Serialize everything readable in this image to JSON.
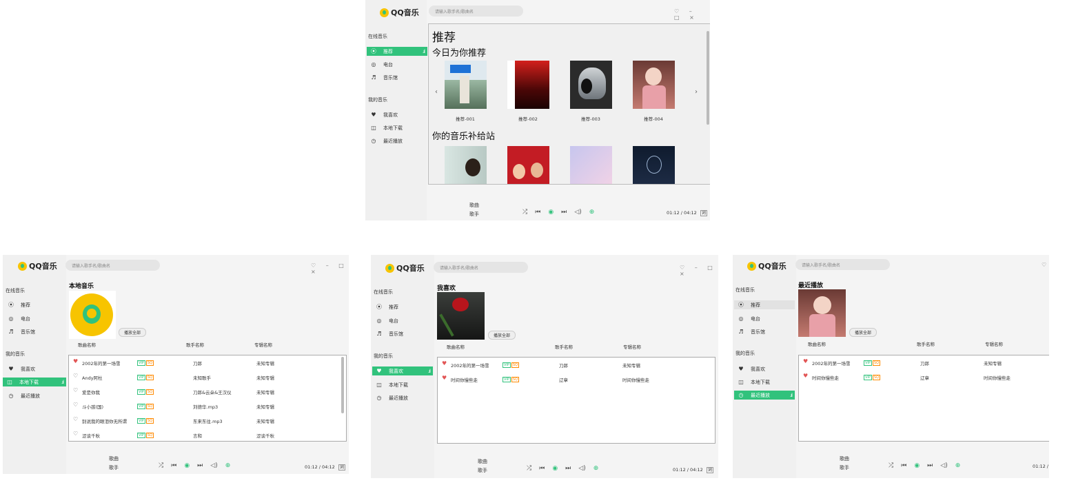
{
  "common": {
    "app_name": "QQ音乐",
    "search_placeholder": "请输入歌手名/歌曲名",
    "window_controls": "♡ – □ ×",
    "section_online": "在线音乐",
    "section_mine": "我的音乐",
    "nav": {
      "recommend": "推荐",
      "radio": "电台",
      "playlist": "音乐馆",
      "favorite": "我喜欢",
      "local": "本地下载",
      "recent": "最近播放"
    },
    "col_song": "歌曲名称",
    "col_singer": "歌手名称",
    "col_album": "专辑名称",
    "play_all": "播放全部",
    "player_song": "歌曲",
    "player_singer": "歌手",
    "player_time": "01:12 / 04:12",
    "lyric_btn": "词",
    "eq_glyph": ".ıl",
    "tag_vip": "VIP",
    "tag_sq": "SQ"
  },
  "recommend_window": {
    "page_title": "推荐",
    "section1": "今日为你推荐",
    "section2": "你的音乐补给站",
    "items": [
      "推荐-001",
      "推荐-002",
      "推荐-003",
      "推荐-004"
    ],
    "prev": "‹",
    "next": "›"
  },
  "local_window": {
    "page_title": "本地音乐",
    "rows": [
      {
        "song": "2002年的第一场雪",
        "singer": "刀郎",
        "album": "未知专辑",
        "liked": true
      },
      {
        "song": "Andy阿杜",
        "singer": "未知歌手",
        "album": "未知专辑",
        "liked": false
      },
      {
        "song": "爱是你我",
        "singer": "刀郎&云朵&王汉仪",
        "album": "未知专辑",
        "liked": false
      },
      {
        "song": "斗小孩(国)",
        "singer": "刘德华.mp3",
        "album": "未知专辑",
        "liked": false
      },
      {
        "song": "别说我的眼泪你无所谓",
        "singer": "东来东往.mp3",
        "album": "未知专辑",
        "liked": false
      },
      {
        "song": "涩谈千秋",
        "singer": "言和",
        "album": "涩谈千秋",
        "liked": false
      }
    ]
  },
  "favorite_window": {
    "page_title": "我喜欢",
    "rows": [
      {
        "song": "2002年的第一场雪",
        "singer": "刀郎",
        "album": "未知专辑",
        "liked": true
      },
      {
        "song": "时间你慢些走",
        "singer": "辽章",
        "album": "时间你慢些走",
        "liked": true
      }
    ]
  },
  "recent_window": {
    "page_title": "最近播放",
    "rows": [
      {
        "song": "2002年的第一场雪",
        "singer": "刀郎",
        "album": "未知专辑",
        "liked": true
      },
      {
        "song": "时间你慢些走",
        "singer": "辽章",
        "album": "时间你慢些走",
        "liked": true
      }
    ]
  },
  "colors": {
    "accent": "#31c27c",
    "heart": "#e25555",
    "sq": "#ff8a00"
  }
}
